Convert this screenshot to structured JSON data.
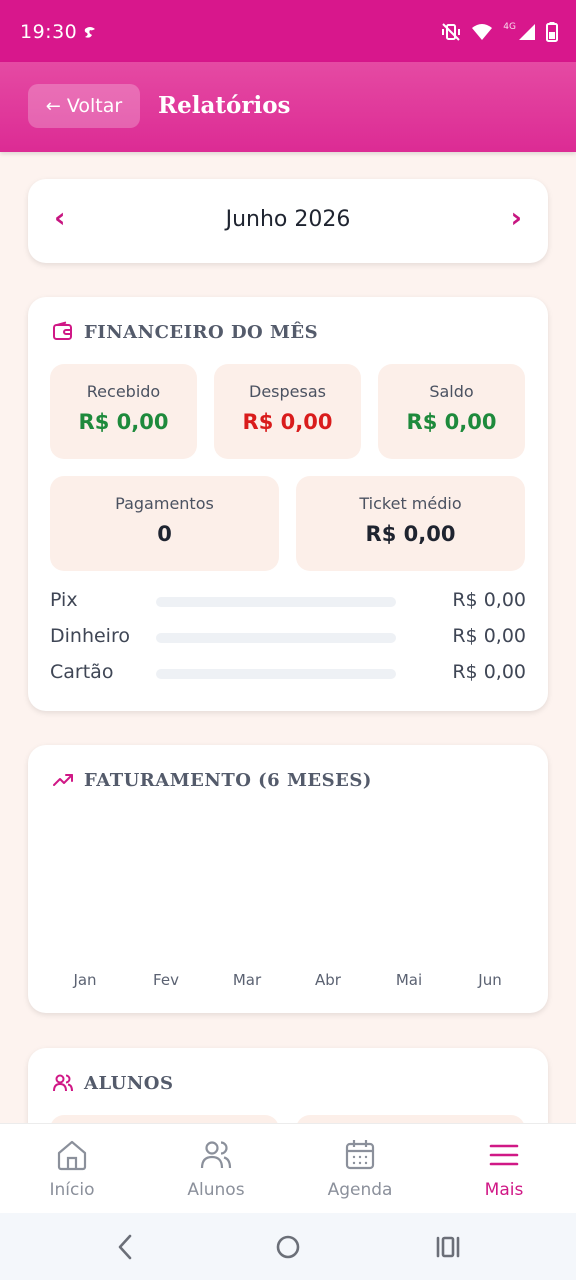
{
  "status_bar": {
    "time": "19:30",
    "network": "4G"
  },
  "app_bar": {
    "back_label": "Voltar",
    "back_arrow": "←",
    "title": "Relatórios"
  },
  "month_selector": {
    "label": "Junho 2026",
    "prev": "‹",
    "next": "›"
  },
  "financeiro": {
    "title": "FINANCEIRO DO MÊS",
    "recebido": {
      "label": "Recebido",
      "value": "R$ 0,00"
    },
    "despesas": {
      "label": "Despesas",
      "value": "R$ 0,00"
    },
    "saldo": {
      "label": "Saldo",
      "value": "R$ 0,00"
    },
    "pagamentos": {
      "label": "Pagamentos",
      "value": "0"
    },
    "ticket": {
      "label": "Ticket médio",
      "value": "R$ 0,00"
    },
    "methods": [
      {
        "label": "Pix",
        "amount": "R$ 0,00",
        "fraction": 0
      },
      {
        "label": "Dinheiro",
        "amount": "R$ 0,00",
        "fraction": 0
      },
      {
        "label": "Cartão",
        "amount": "R$ 0,00",
        "fraction": 0
      }
    ]
  },
  "faturamento": {
    "title": "FATURAMENTO (6 MESES)",
    "chart_data": {
      "type": "bar",
      "categories": [
        "Jan",
        "Fev",
        "Mar",
        "Abr",
        "Mai",
        "Jun"
      ],
      "values": [
        0,
        0,
        0,
        0,
        0,
        0
      ],
      "title": "FATURAMENTO (6 MESES)"
    }
  },
  "alunos": {
    "title": "ALUNOS"
  },
  "bottom_nav": [
    {
      "label": "Início",
      "icon": "home-icon",
      "active": false
    },
    {
      "label": "Alunos",
      "icon": "users-icon",
      "active": false
    },
    {
      "label": "Agenda",
      "icon": "calendar-icon",
      "active": false
    },
    {
      "label": "Mais",
      "icon": "menu-icon",
      "active": true
    }
  ],
  "colors": {
    "brand": "#d8178c",
    "accent": "#c71580",
    "positive": "#1e8a3c",
    "negative": "#d91c1c",
    "stat_bg": "#fcefe9"
  }
}
